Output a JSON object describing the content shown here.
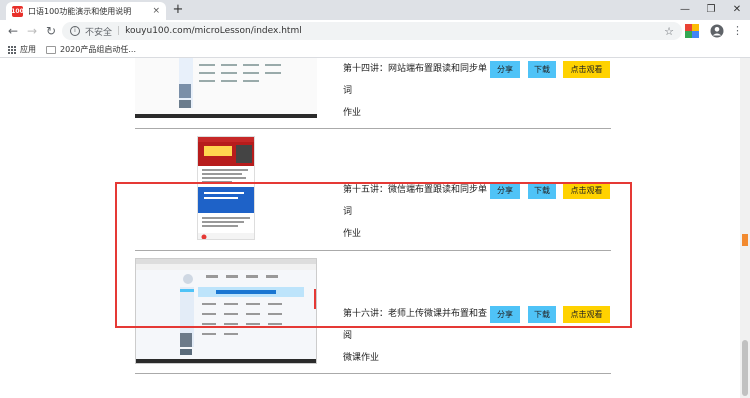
{
  "tab": {
    "title": "口语100功能演示和使用说明",
    "favicon": "100",
    "close": "×",
    "new": "+"
  },
  "window": {
    "minimize": "—",
    "restore": "❐",
    "close": "✕"
  },
  "toolbar": {
    "security": "不安全",
    "url": "kouyu100.com/microLesson/index.html",
    "star": "☆"
  },
  "bookmarks": [
    {
      "label": "应用"
    },
    {
      "label": "2020产品组启动任..."
    }
  ],
  "lessons": [
    {
      "line1": "第十四讲：网站端布置跟读和同步单词",
      "line2": "作业",
      "share": "分享",
      "download": "下载",
      "watch": "点击观看"
    },
    {
      "line1": "第十五讲：微信端布置跟读和同步单词",
      "line2": "作业",
      "share": "分享",
      "download": "下载",
      "watch": "点击观看"
    },
    {
      "line1": "第十六讲：老师上传微课并布置和查阅",
      "line2": "微课作业",
      "share": "分享",
      "download": "下载",
      "watch": "点击观看"
    }
  ],
  "colors": {
    "accent": "#4fc3f7",
    "watch": "#ffd200",
    "highlight": "#e53935"
  }
}
